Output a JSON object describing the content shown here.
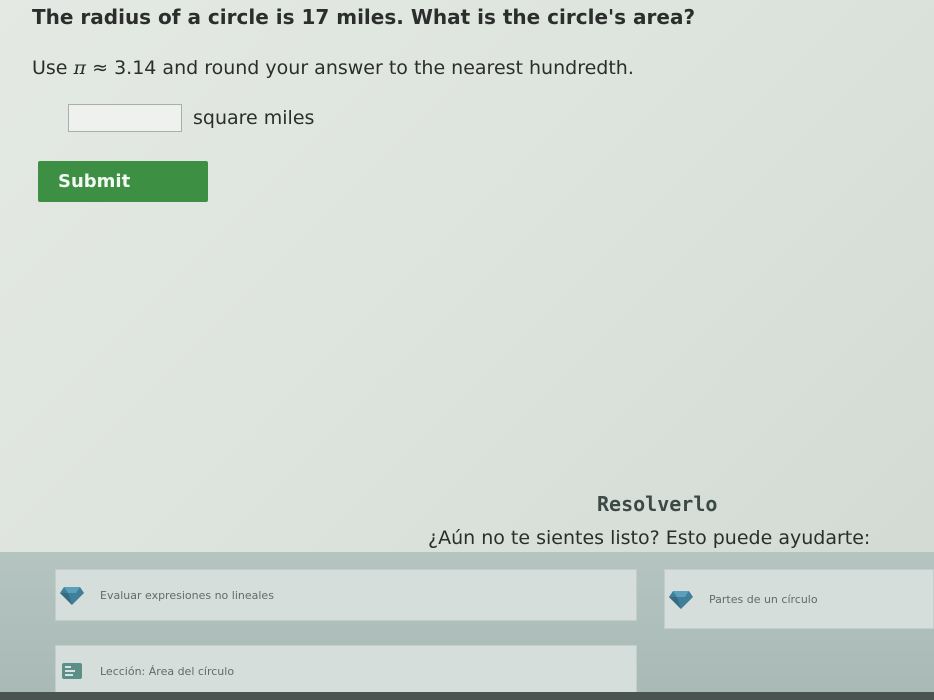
{
  "problem": {
    "question": "The radius of a circle is 17 miles. What is the circle's area?",
    "instruction_prefix": "Use",
    "pi_symbol": "π",
    "approx_symbol": "≈",
    "pi_value": "3.14",
    "instruction_suffix": "and round your answer to the nearest hundredth."
  },
  "answer": {
    "value": "",
    "placeholder": "",
    "unit": "square miles"
  },
  "submit": {
    "label": "Submit",
    "color": "#3d8f43"
  },
  "help": {
    "title": "Resolverlo",
    "subtitle": "¿Aún no te sientes listo? Esto puede ayudarte:",
    "resources": [
      {
        "label": "Evaluar expresiones no lineales",
        "icon": "diamond-icon"
      },
      {
        "label": "Partes de un círculo",
        "icon": "diamond-icon"
      },
      {
        "label": "Lección: Área del círculo",
        "icon": "lesson-icon"
      }
    ]
  }
}
